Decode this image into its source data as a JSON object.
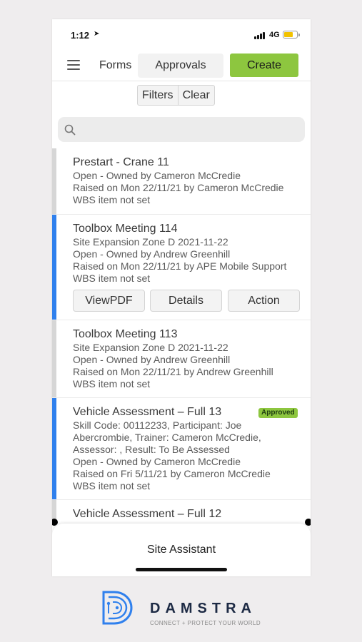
{
  "status_bar": {
    "time": "1:12",
    "location_icon": "location-arrow-icon",
    "network": "4G",
    "battery_color": "#f2c200"
  },
  "toolbar": {
    "menu_icon": "hamburger-menu-icon",
    "forms_tab": "Forms",
    "approvals_tab": "Approvals",
    "create_label": "Create",
    "accent_color": "#8dc63f"
  },
  "filter_bar": {
    "filters_label": "Filters",
    "clear_label": "Clear"
  },
  "search": {
    "icon": "search-icon",
    "placeholder": ""
  },
  "cards": [
    {
      "title": "Prestart - Crane 11",
      "lines": [
        "Open - Owned by Cameron McCredie",
        "Raised on Mon 22/11/21 by Cameron McCredie",
        "WBS item not set"
      ],
      "status_color": "#d6d6d6"
    },
    {
      "title": "Toolbox Meeting 114",
      "lines": [
        "Site Expansion Zone D 2021-11-22",
        "Open - Owned by Andrew Greenhill",
        "Raised on Mon 22/11/21 by APE Mobile Support",
        "WBS item not set"
      ],
      "status_color": "#2f80ed",
      "actions": {
        "view_pdf": "ViewPDF",
        "details": "Details",
        "action": "Action"
      }
    },
    {
      "title": "Toolbox Meeting 113",
      "lines": [
        "Site Expansion Zone D 2021-11-22",
        "Open - Owned by Andrew Greenhill",
        "Raised on Mon 22/11/21 by Andrew Greenhill",
        "WBS item not set"
      ],
      "status_color": "#d6d6d6"
    },
    {
      "title": "Vehicle Assessment – Full 13",
      "badge": "Approved",
      "lines": [
        "Skill Code: 00112233, Participant: Joe",
        "Abercrombie, Trainer: Cameron McCredie,",
        "Assessor: , Result: To Be Assessed",
        "Open - Owned by Cameron McCredie",
        "Raised on Fri 5/11/21 by Cameron McCredie",
        "WBS item not set"
      ],
      "status_color": "#2f80ed"
    },
    {
      "title": "Vehicle Assessment – Full 12",
      "lines": [],
      "status_color": "#d6d6d6"
    }
  ],
  "bottom_sheet": {
    "label": "Site Assistant"
  },
  "brand": {
    "logo_icon": "damstra-logo-icon",
    "name": "DAMSTRA",
    "tagline": "CONNECT + PROTECT YOUR WORLD",
    "color": "#1d2a44",
    "logo_color": "#2f80ed"
  }
}
